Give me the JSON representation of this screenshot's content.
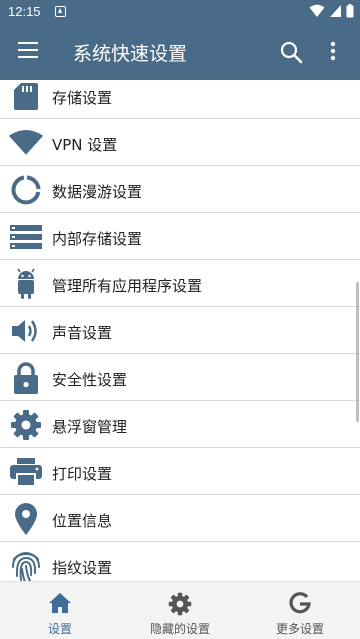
{
  "status": {
    "time": "12:15"
  },
  "appbar": {
    "title": "系统快速设置"
  },
  "items": [
    {
      "label": "存储设置",
      "icon": "sd-card-icon"
    },
    {
      "label": "VPN 设置",
      "icon": "vpn-wifi-icon"
    },
    {
      "label": "数据漫游设置",
      "icon": "data-usage-icon"
    },
    {
      "label": "内部存储设置",
      "icon": "storage-icon"
    },
    {
      "label": "管理所有应用程序设置",
      "icon": "android-icon"
    },
    {
      "label": "声音设置",
      "icon": "volume-icon"
    },
    {
      "label": "安全性设置",
      "icon": "lock-icon"
    },
    {
      "label": "悬浮窗管理",
      "icon": "gear-icon"
    },
    {
      "label": "打印设置",
      "icon": "printer-icon"
    },
    {
      "label": "位置信息",
      "icon": "location-pin-icon"
    },
    {
      "label": "指纹设置",
      "icon": "fingerprint-icon"
    }
  ],
  "bottom_nav": [
    {
      "label": "设置",
      "icon": "home-icon",
      "active": true
    },
    {
      "label": "隐藏的设置",
      "icon": "gear-icon",
      "active": false
    },
    {
      "label": "更多设置",
      "icon": "google-g-icon",
      "active": false
    }
  ],
  "colors": {
    "primary": "#4a6b88",
    "icon": "#4a6b88",
    "active_tab": "#3f6d9a"
  }
}
